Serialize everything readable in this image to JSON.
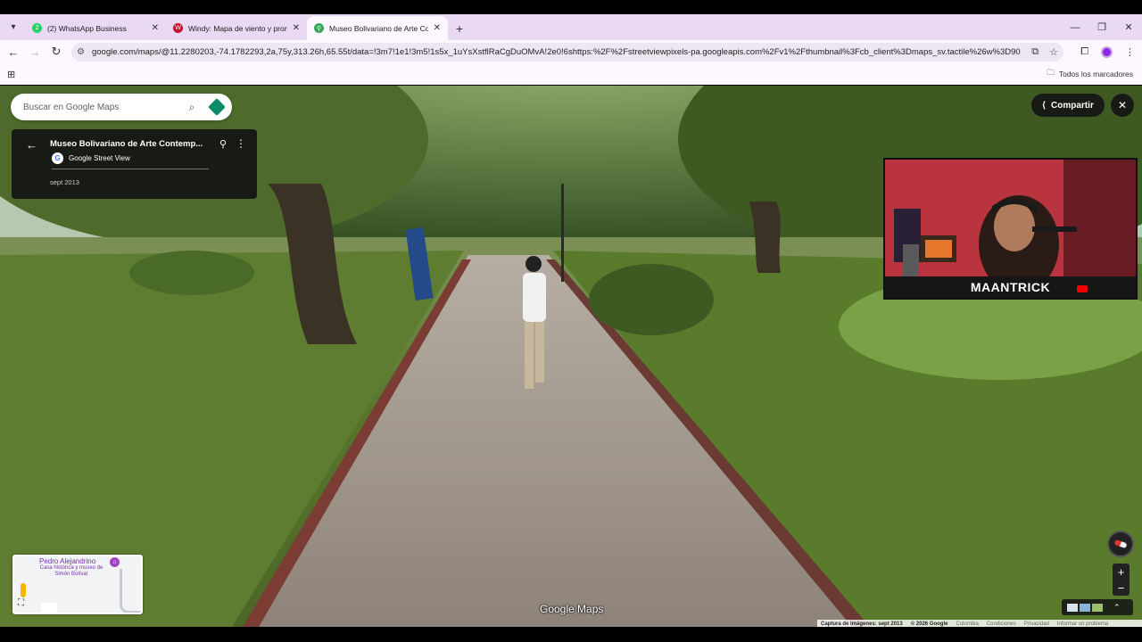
{
  "browser": {
    "tabs": [
      {
        "title": "(2) WhatsApp Business",
        "favicon_color": "#25D366",
        "favicon_glyph": "2"
      },
      {
        "title": "Windy: Mapa de viento y pronó",
        "favicon_color": "#c8102e",
        "favicon_glyph": "W"
      },
      {
        "title": "Museo Bolivariano de Arte Con",
        "favicon_color": "#34a853",
        "favicon_glyph": "⚲",
        "active": true
      }
    ],
    "new_tab": "+",
    "url": "google.com/maps/@11.2280203,-74.1782293,2a,75y,313.26h,65.55t/data=!3m7!1e1!3m5!1s5x_1uYsXstflRaCgDuOMvA!2e0!6shttps:%2F%2Fstreetviewpixels-pa.googleapis.com%2Fv1%2Fthumbnail%3Fcb_client%3Dmaps_sv.tactile%26w%3D900%26h...",
    "bookmarks_label": "Todos los marcadores"
  },
  "maps": {
    "search_placeholder": "Buscar en Google Maps",
    "place_name": "Museo Bolivariano de Arte Contemp...",
    "source": "Google Street View",
    "date": "sept 2013",
    "share_label": "Compartir",
    "brand": "Google Maps",
    "minimap": {
      "label1": "Pedro Alejandrino",
      "label2": "Casa histórica y museo de Simón Bolívar"
    },
    "footer": {
      "capture": "Captura de imágenes: sept 2013",
      "copyright": "© 2026 Google",
      "country": "Colombia",
      "terms": "Condiciones",
      "privacy": "Privacidad",
      "report": "Informar un problema"
    }
  },
  "webcam": {
    "caption": "MAANTRICK"
  }
}
